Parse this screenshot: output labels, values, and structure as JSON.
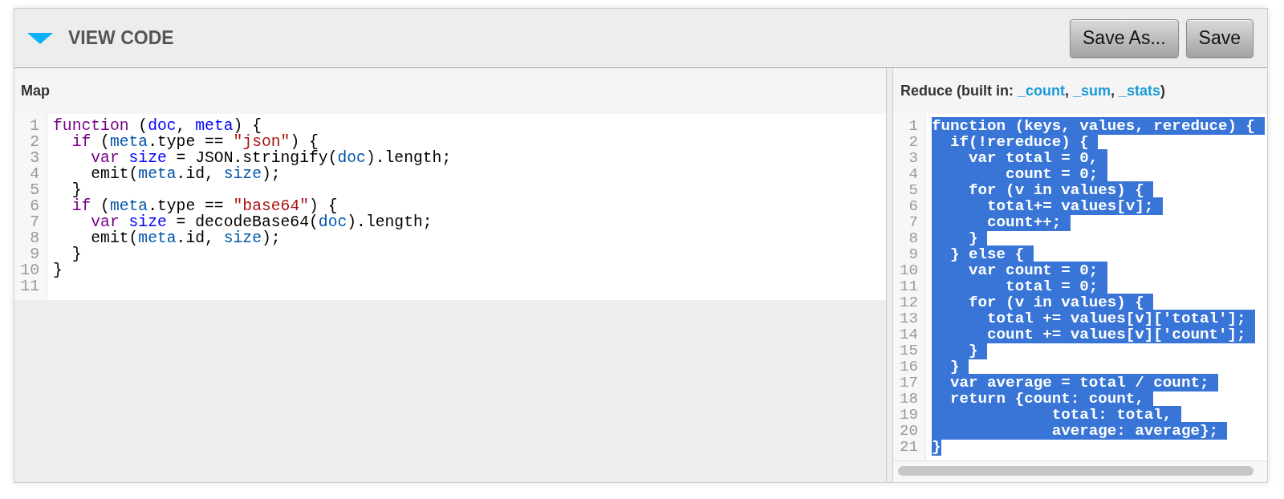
{
  "section": {
    "title": "VIEW CODE",
    "expanded": true
  },
  "buttons": [
    "Save As...",
    "Save"
  ],
  "editors": [
    {
      "title_parts": [
        {
          "text": "Map",
          "kind": "text"
        }
      ],
      "selected": false,
      "horizontal_scrollbar": false,
      "lines": [
        {
          "number": "1",
          "tokens": [
            {
              "text": "function",
              "kind": "keyword"
            },
            {
              "text": " (",
              "kind": "plain"
            },
            {
              "text": "doc",
              "kind": "def"
            },
            {
              "text": ", ",
              "kind": "plain"
            },
            {
              "text": "meta",
              "kind": "def"
            },
            {
              "text": ") {",
              "kind": "plain"
            }
          ]
        },
        {
          "number": "2",
          "tokens": [
            {
              "text": "  if",
              "kind": "keyword"
            },
            {
              "text": " (",
              "kind": "plain"
            },
            {
              "text": "meta",
              "kind": "variable"
            },
            {
              "text": ".type == ",
              "kind": "plain"
            },
            {
              "text": "\"json\"",
              "kind": "string"
            },
            {
              "text": ") {",
              "kind": "plain"
            }
          ]
        },
        {
          "number": "3",
          "tokens": [
            {
              "text": "    var",
              "kind": "keyword"
            },
            {
              "text": " size",
              "kind": "def"
            },
            {
              "text": " = JSON.stringify(",
              "kind": "plain"
            },
            {
              "text": "doc",
              "kind": "variable"
            },
            {
              "text": ").length;",
              "kind": "plain"
            }
          ]
        },
        {
          "number": "4",
          "tokens": [
            {
              "text": "    emit(",
              "kind": "plain"
            },
            {
              "text": "meta",
              "kind": "variable"
            },
            {
              "text": ".id, ",
              "kind": "plain"
            },
            {
              "text": "size",
              "kind": "variable"
            },
            {
              "text": ");",
              "kind": "plain"
            }
          ]
        },
        {
          "number": "5",
          "tokens": [
            {
              "text": "  }",
              "kind": "plain"
            }
          ]
        },
        {
          "number": "6",
          "tokens": [
            {
              "text": "  if",
              "kind": "keyword"
            },
            {
              "text": " (",
              "kind": "plain"
            },
            {
              "text": "meta",
              "kind": "variable"
            },
            {
              "text": ".type == ",
              "kind": "plain"
            },
            {
              "text": "\"base64\"",
              "kind": "string"
            },
            {
              "text": ") {",
              "kind": "plain"
            }
          ]
        },
        {
          "number": "7",
          "tokens": [
            {
              "text": "    var",
              "kind": "keyword"
            },
            {
              "text": " size",
              "kind": "def"
            },
            {
              "text": " = decodeBase64(",
              "kind": "plain"
            },
            {
              "text": "doc",
              "kind": "variable"
            },
            {
              "text": ").length;",
              "kind": "plain"
            }
          ]
        },
        {
          "number": "8",
          "tokens": [
            {
              "text": "    emit(",
              "kind": "plain"
            },
            {
              "text": "meta",
              "kind": "variable"
            },
            {
              "text": ".id, ",
              "kind": "plain"
            },
            {
              "text": "size",
              "kind": "variable"
            },
            {
              "text": ");",
              "kind": "plain"
            }
          ]
        },
        {
          "number": "9",
          "tokens": [
            {
              "text": "  }",
              "kind": "plain"
            }
          ]
        },
        {
          "number": "10",
          "tokens": [
            {
              "text": "}",
              "kind": "plain"
            }
          ]
        },
        {
          "number": "11"
        }
      ]
    },
    {
      "title_parts": [
        {
          "text": "Reduce (built in: ",
          "kind": "text"
        },
        {
          "text": "_count",
          "kind": "link"
        },
        {
          "text": ", ",
          "kind": "text"
        },
        {
          "text": "_sum",
          "kind": "link"
        },
        {
          "text": ", ",
          "kind": "text"
        },
        {
          "text": "_stats",
          "kind": "link"
        },
        {
          "text": ")",
          "kind": "text"
        }
      ],
      "selected": true,
      "horizontal_scrollbar": true,
      "lines": [
        {
          "number": "1",
          "text": "function (keys, values, rereduce) {"
        },
        {
          "number": "2",
          "text": "  if(!rereduce) {"
        },
        {
          "number": "3",
          "text": "    var total = 0,"
        },
        {
          "number": "4",
          "text": "        count = 0;"
        },
        {
          "number": "5",
          "text": "    for (v in values) {"
        },
        {
          "number": "6",
          "text": "      total+= values[v];"
        },
        {
          "number": "7",
          "text": "      count++;"
        },
        {
          "number": "8",
          "text": "    }"
        },
        {
          "number": "9",
          "text": "  } else {"
        },
        {
          "number": "10",
          "text": "    var count = 0;"
        },
        {
          "number": "11",
          "text": "        total = 0;"
        },
        {
          "number": "12",
          "text": "    for (v in values) {"
        },
        {
          "number": "13",
          "text": "      total += values[v]['total'];"
        },
        {
          "number": "14",
          "text": "      count += values[v]['count'];"
        },
        {
          "number": "15",
          "text": "    }"
        },
        {
          "number": "16",
          "text": "  }"
        },
        {
          "number": "17",
          "text": "  var average = total / count;"
        },
        {
          "number": "18",
          "text": "  return {count: count,"
        },
        {
          "number": "19",
          "text": "             total: total,"
        },
        {
          "number": "20",
          "text": "             average: average};"
        },
        {
          "number": "21",
          "text": "}"
        }
      ]
    }
  ]
}
